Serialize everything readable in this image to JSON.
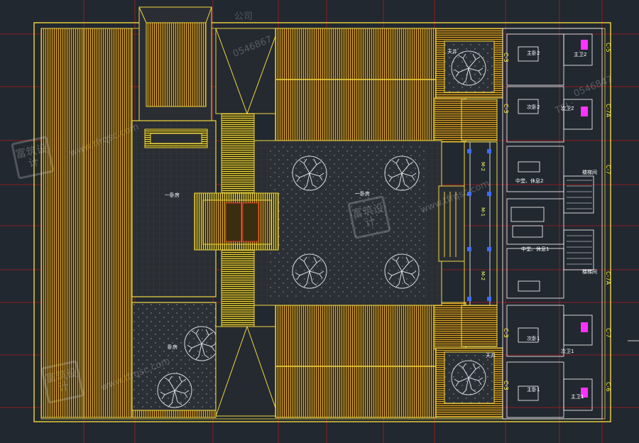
{
  "drawing": {
    "rooms": {
      "hall_left": "一卧房",
      "hall_center": "一卧房",
      "lower_left_room": "卧房",
      "top_right_courtyard": "天井",
      "bottom_right_courtyard": "天井",
      "master_2": "主卧2",
      "master_bath_2": "主卫2",
      "guest_2": "次卧2",
      "guest_bath_2": "次卫2",
      "dining_2": "中堂、休息2",
      "dining_1": "中堂、休息1",
      "guest_1": "次卧1",
      "guest_bath_1": "次卫1",
      "master_1": "主卧1",
      "master_bath_1": "主卫1",
      "stair_upper": "楼梯间",
      "stair_lower": "楼梯间"
    },
    "door_tags": {
      "m2_upper": "M-2",
      "m1": "M-1",
      "m2_lower": "M-2"
    },
    "window_tags": {
      "c3_top": "C-3",
      "c5": "C-5",
      "c7a_top": "C-7A",
      "c3_mid": "C-3",
      "c7": "C-7",
      "c7a_bottom": "C-7A",
      "c7_right": "C-7",
      "c3_bottom": "C-3",
      "c3_lower": "C-3",
      "c6": "C-6"
    },
    "watermarks": {
      "top_line": "公司",
      "phone_top": "0546867",
      "phone_right": "0546847",
      "tel": "TEL:",
      "url": "www.tfrqsc.com",
      "stamp": "富筑设计"
    }
  }
}
